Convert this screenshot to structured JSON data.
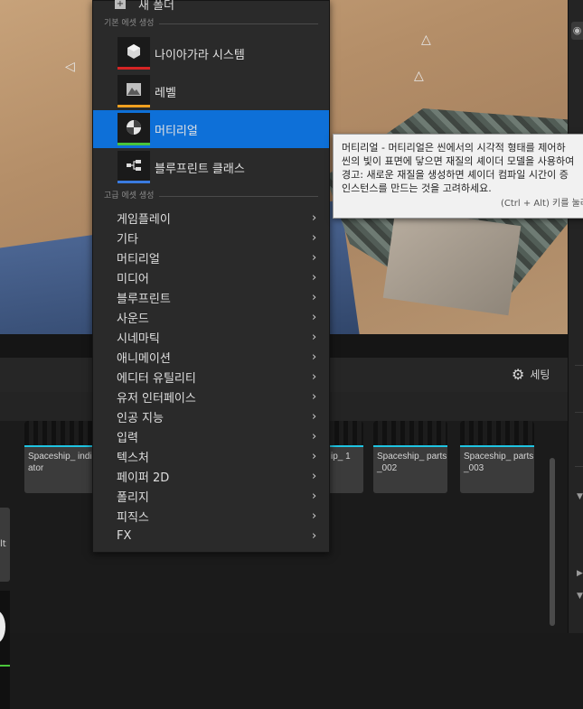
{
  "menu": {
    "new_folder_label": "새 폴더",
    "basic_header": "기본 에셋 생성",
    "advanced_header": "고급 에셋 생성",
    "basic_items": [
      {
        "label": "나이아가라 시스템",
        "icon": "niagara-system-icon",
        "stripe": "#d42424",
        "selected": false
      },
      {
        "label": "레벨",
        "icon": "level-icon",
        "stripe": "#f0a020",
        "selected": false
      },
      {
        "label": "머티리얼",
        "icon": "material-icon",
        "stripe": "#49c43a",
        "selected": true
      },
      {
        "label": "블루프린트 클래스",
        "icon": "blueprint-class-icon",
        "stripe": "#3a7be0",
        "selected": false
      }
    ],
    "advanced_items": [
      {
        "label": "게임플레이"
      },
      {
        "label": "기타"
      },
      {
        "label": "머티리얼"
      },
      {
        "label": "미디어"
      },
      {
        "label": "블루프린트"
      },
      {
        "label": "사운드"
      },
      {
        "label": "시네마틱"
      },
      {
        "label": "애니메이션"
      },
      {
        "label": "에디터 유틸리티"
      },
      {
        "label": "유저 인터페이스"
      },
      {
        "label": "인공 지능"
      },
      {
        "label": "입력"
      },
      {
        "label": "텍스처"
      },
      {
        "label": "페이퍼 2D"
      },
      {
        "label": "폴리지"
      },
      {
        "label": "피직스"
      },
      {
        "label": "FX"
      }
    ]
  },
  "tooltip": {
    "line1": "머티리얼 - 머티리얼은 씬에서의 시각적 형태를 제어하",
    "line2": "씬의 빛이 표면에 닿으면 재질의 셰이더 모델을 사용하여",
    "line3": "경고: 새로운 재질을 생성하면 셰이더 컴파일 시간이 증",
    "line4": "인스턴스를 만드는 것을 고려하세요.",
    "shortcut": "(Ctrl + Alt) 키를 눌러"
  },
  "browser": {
    "settings_label": "세팅",
    "tiles": [
      {
        "name": "lt"
      },
      {
        "name": "Spaceship_ indicator"
      },
      {
        "name": "ip_ 1"
      },
      {
        "name": "Spaceship_ parts_002"
      },
      {
        "name": "Spaceship_ parts_003"
      }
    ]
  },
  "colors": {
    "selection": "#0e70d8",
    "asset_bar": "#1fc4e2"
  }
}
